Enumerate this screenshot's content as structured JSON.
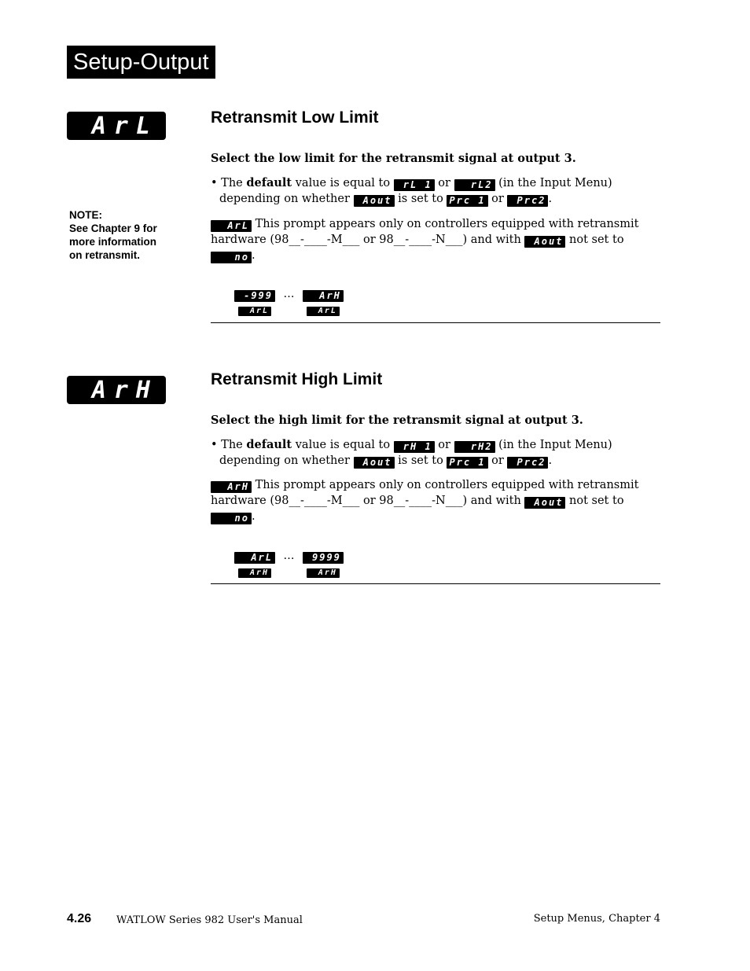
{
  "section_title": "Setup-Output",
  "note": {
    "label": "NOTE:",
    "lines": [
      "See Chapter 9 for",
      "more information",
      "on retransmit."
    ]
  },
  "sections": [
    {
      "display": "ArL",
      "heading": "Retransmit Low Limit",
      "lead": "Select the low limit for the retransmit signal at output 3.",
      "bullet": {
        "prefix": "• The ",
        "bold": "default",
        "t1": " value is equal to ",
        "code1": "rL 1",
        "t2": " or ",
        "code2": "rL2",
        "t3": " (in the Input Menu)",
        "t4": "depending on whether ",
        "code3": "Aout",
        "t5": " is set to ",
        "code4": "Prc 1",
        "t6": " or ",
        "code5": "Prc2",
        "t7": "."
      },
      "prompt": {
        "code": "ArL",
        "t1": " This prompt appears only on controllers equipped with retransmit hardware (98__-____-M___ or 98__-____-N___) and with ",
        "code2": "Aout",
        "t2": " not set to ",
        "code3": "no",
        "t3": "."
      },
      "range": {
        "low": "-999",
        "ellipsis": "…",
        "high": "ArH",
        "low_sub": "ArL",
        "high_sub": "ArL"
      }
    },
    {
      "display": "ArH",
      "heading": "Retransmit High Limit",
      "lead": "Select the high limit for the retransmit signal at output 3.",
      "bullet": {
        "prefix": "• The ",
        "bold": "default",
        "t1": " value is equal to ",
        "code1": "rH 1",
        "t2": " or ",
        "code2": "rH2",
        "t3": " (in the Input Menu)",
        "t4": "depending on whether ",
        "code3": "Aout",
        "t5": " is set to ",
        "code4": "Prc 1",
        "t6": " or ",
        "code5": "Prc2",
        "t7": "."
      },
      "prompt": {
        "code": "ArH",
        "t1": " This prompt appears only on controllers equipped with retransmit hardware (98__-____-M___ or 98__-____-N___) and with ",
        "code2": "Aout",
        "t2": " not set to ",
        "code3": "no",
        "t3": "."
      },
      "range": {
        "low": "ArL",
        "ellipsis": "…",
        "high": "9999",
        "low_sub": "ArH",
        "high_sub": "ArH"
      }
    }
  ],
  "footer": {
    "page_number": "4.26",
    "manual": "WATLOW Series 982 User's Manual",
    "chapter": "Setup Menus, Chapter 4"
  }
}
